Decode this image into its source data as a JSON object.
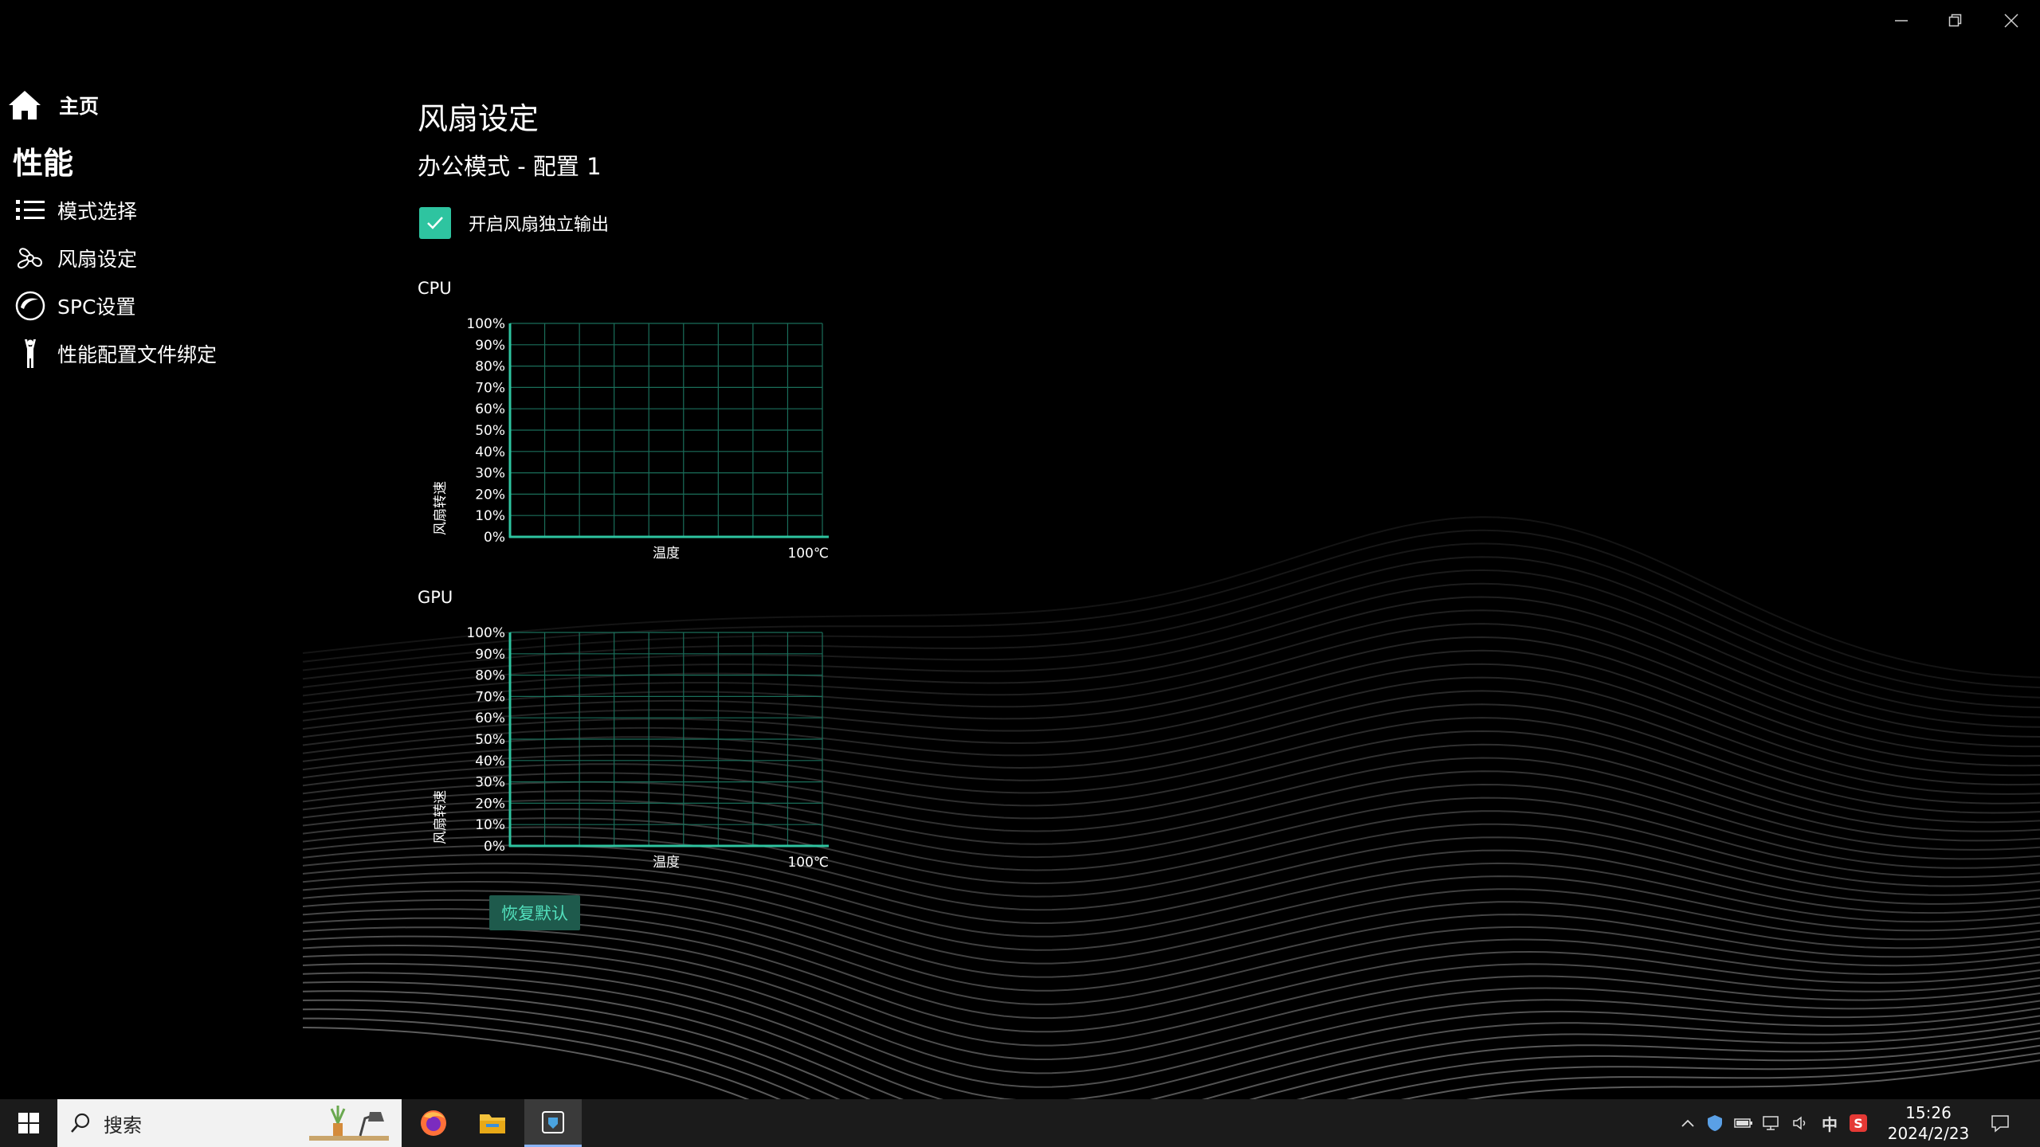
{
  "window": {
    "minimize_icon": "minimize-icon",
    "restore_icon": "restore-icon",
    "close_icon": "close-icon"
  },
  "sidebar": {
    "home": {
      "label": "主页",
      "icon": "home-icon"
    },
    "section_title": "性能",
    "items": [
      {
        "label": "模式选择",
        "icon": "list-icon"
      },
      {
        "label": "风扇设定",
        "icon": "fan-icon"
      },
      {
        "label": "SPC设置",
        "icon": "spc-icon"
      },
      {
        "label": "性能配置文件绑定",
        "icon": "figure-icon"
      }
    ]
  },
  "main": {
    "title": "风扇设定",
    "subtitle": "办公模式 - 配置 1",
    "independent_output": {
      "label": "开启风扇独立输出",
      "checked": true
    },
    "reset_label": "恢复默认"
  },
  "chart_data": [
    {
      "type": "line",
      "title": "CPU",
      "xlabel": "温度",
      "x_max_label": "100℃",
      "ylabel": "风扇转速",
      "yticks": [
        "0%",
        "10%",
        "20%",
        "30%",
        "40%",
        "50%",
        "60%",
        "70%",
        "80%",
        "90%",
        "100%"
      ],
      "ylim": [
        0,
        100
      ],
      "grid": true,
      "series": []
    },
    {
      "type": "line",
      "title": "GPU",
      "xlabel": "温度",
      "x_max_label": "100℃",
      "ylabel": "风扇转速",
      "yticks": [
        "0%",
        "10%",
        "20%",
        "30%",
        "40%",
        "50%",
        "60%",
        "70%",
        "80%",
        "90%",
        "100%"
      ],
      "ylim": [
        0,
        100
      ],
      "grid": true,
      "series": []
    }
  ],
  "colors": {
    "accent": "#2ec4a0",
    "grid": "#1a6e5a",
    "button_bg": "#1e5a4c",
    "button_text": "#52e0bd"
  },
  "taskbar": {
    "search_placeholder": "搜索",
    "apps": [
      "firefox-icon",
      "file-explorer-icon",
      "app-icon"
    ],
    "ime": "中",
    "sogou": "S",
    "time": "15:26",
    "date": "2024/2/23"
  }
}
